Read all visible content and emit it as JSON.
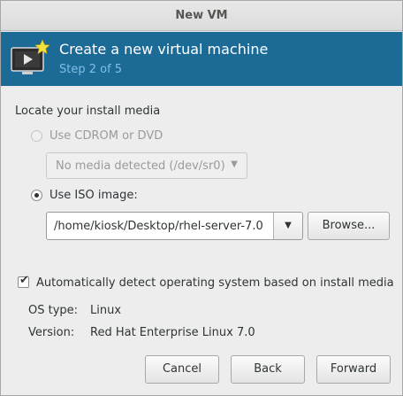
{
  "window": {
    "title": "New VM"
  },
  "banner": {
    "title": "Create a new virtual machine",
    "step": "Step 2 of 5"
  },
  "install_media": {
    "section_label": "Locate your install media",
    "cdrom_label": "Use CDROM or DVD",
    "cdrom_selected": false,
    "cdrom_enabled": false,
    "cdrom_combo_value": "No media detected (/dev/sr0)",
    "iso_label": "Use ISO image:",
    "iso_selected": true,
    "iso_path": "/home/kiosk/Desktop/rhel-server-7.0",
    "browse_label": "Browse..."
  },
  "os_detect": {
    "checkbox_label": "Automatically detect operating system based on install media",
    "checked": true,
    "os_type_label": "OS type:",
    "os_type_value": "Linux",
    "version_label": "Version:",
    "version_value": "Red Hat Enterprise Linux 7.0"
  },
  "buttons": {
    "cancel": "Cancel",
    "back": "Back",
    "forward": "Forward"
  },
  "colors": {
    "banner": "#1c6a96",
    "step_text": "#7fbfe6"
  },
  "icons": {
    "banner": "vm-monitor-icon",
    "dropdown": "chevron-down-icon",
    "check": "checkmark-icon"
  }
}
